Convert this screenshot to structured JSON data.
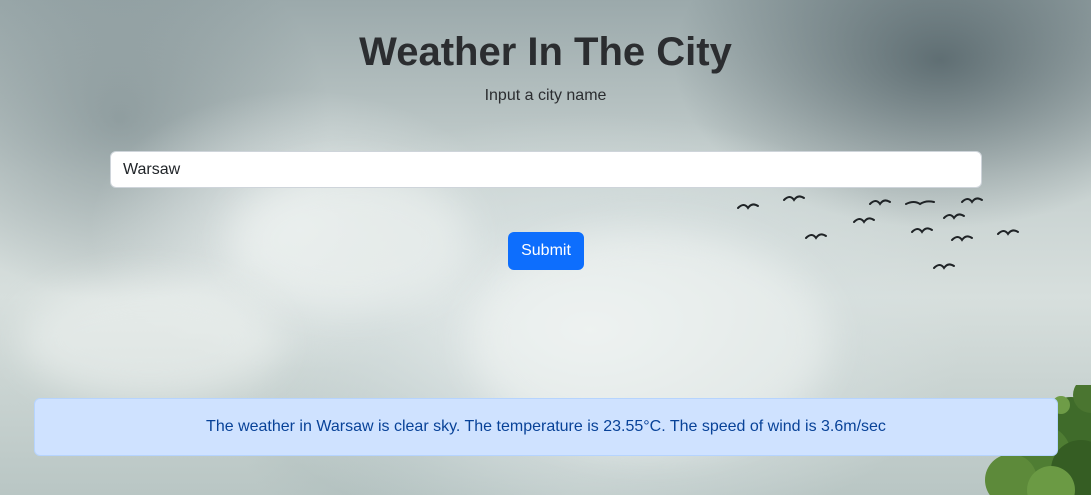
{
  "page": {
    "title": "Weather In The City",
    "subtitle": "Input a city name"
  },
  "form": {
    "city_value": "Warsaw",
    "submit_label": "Submit"
  },
  "result": {
    "message": "The weather in Warsaw is clear sky. The temperature is 23.55°C. The speed of wind is 3.6m/sec"
  },
  "colors": {
    "primary_button": "#0d6efd",
    "alert_background": "#cfe2ff",
    "alert_text": "#084298"
  },
  "background": {
    "image": "cloudy-sky-with-birds-and-trees"
  }
}
